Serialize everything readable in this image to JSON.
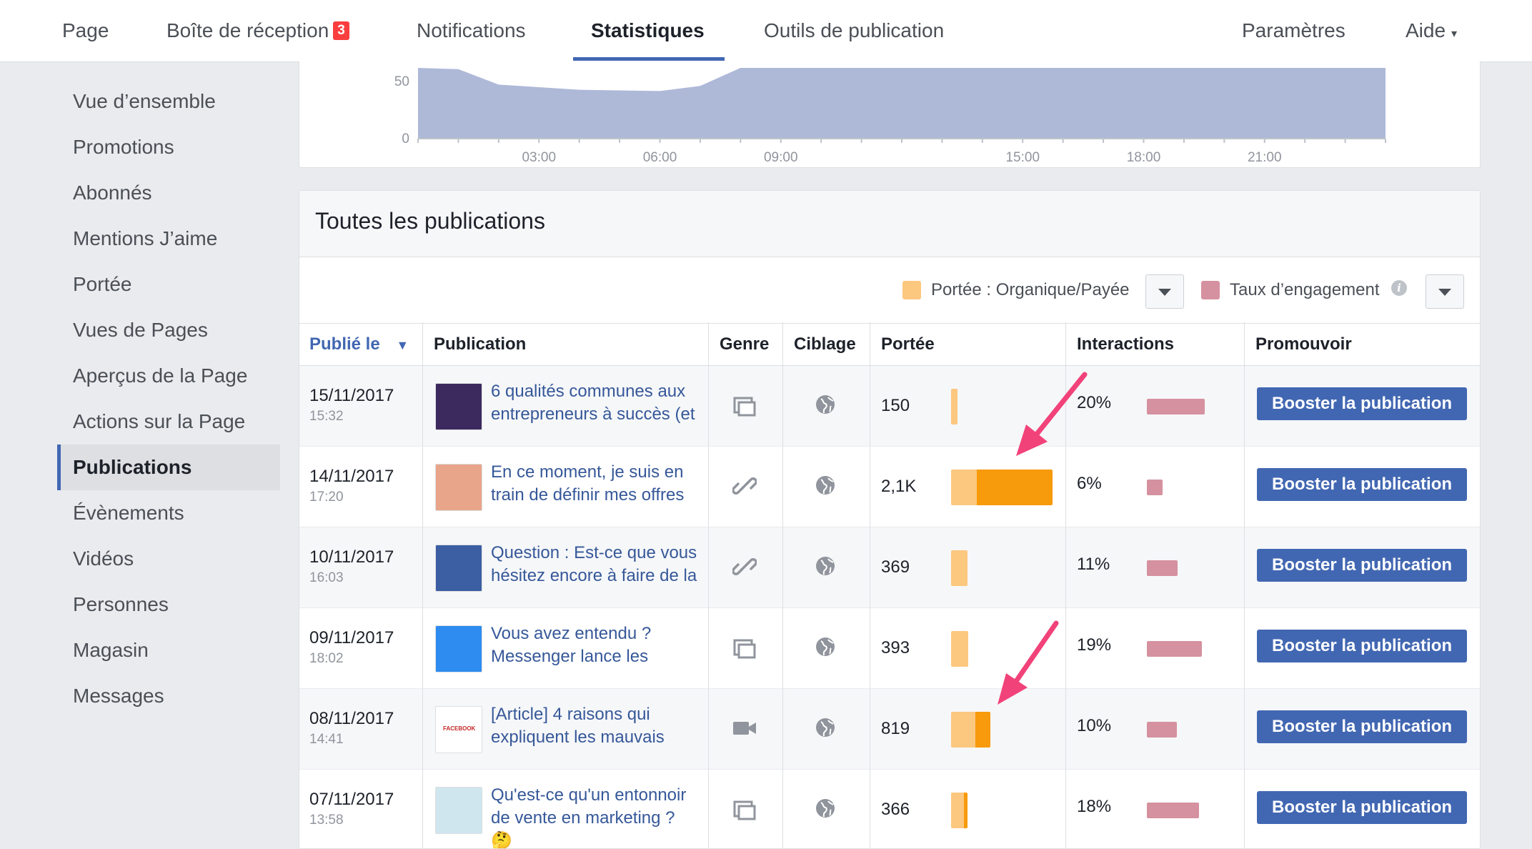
{
  "topnav": {
    "tabs": [
      {
        "label": "Page"
      },
      {
        "label": "Boîte de réception",
        "badge": "3"
      },
      {
        "label": "Notifications"
      },
      {
        "label": "Statistiques",
        "active": true
      },
      {
        "label": "Outils de publication"
      }
    ],
    "right": [
      {
        "label": "Paramètres"
      },
      {
        "label": "Aide",
        "caret": "▾"
      }
    ]
  },
  "sidebar": {
    "items": [
      {
        "label": "Vue d’ensemble"
      },
      {
        "label": "Promotions"
      },
      {
        "label": "Abonnés"
      },
      {
        "label": "Mentions J’aime"
      },
      {
        "label": "Portée"
      },
      {
        "label": "Vues de Pages"
      },
      {
        "label": "Aperçus de la Page"
      },
      {
        "label": "Actions sur la Page"
      },
      {
        "label": "Publications",
        "active": true
      },
      {
        "label": "Évènements"
      },
      {
        "label": "Vidéos"
      },
      {
        "label": "Personnes"
      },
      {
        "label": "Magasin"
      },
      {
        "label": "Messages"
      }
    ]
  },
  "chart_data": {
    "type": "area",
    "y_ticks": [
      "50",
      "0"
    ],
    "x_ticks": [
      "03:00",
      "06:00",
      "09:00",
      "15:00",
      "18:00",
      "21:00"
    ],
    "x_hours": [
      0,
      1,
      2,
      3,
      4,
      5,
      6,
      7,
      8,
      9,
      10,
      11,
      12,
      13,
      14,
      15,
      16,
      17,
      18,
      19,
      20,
      21,
      22,
      23,
      24
    ],
    "values": [
      55,
      54,
      42,
      40,
      38,
      37.5,
      37,
      41,
      55,
      55,
      55,
      55,
      55,
      55,
      55,
      55,
      55,
      55,
      55,
      55,
      55,
      55,
      55,
      55,
      55
    ],
    "ylim": [
      0,
      50
    ],
    "color": "#aeb9d8"
  },
  "publications": {
    "title": "Toutes les publications",
    "legend": {
      "reach_label": "Portée : Organique/Payée",
      "reach_color": "#fcc77f",
      "engagement_label": "Taux d’engagement",
      "engagement_color": "#d5919f",
      "info": "i"
    },
    "columns": {
      "published": "Publié le",
      "sort_icon": "▼",
      "publication": "Publication",
      "genre": "Genre",
      "targeting": "Ciblage",
      "reach": "Portée",
      "interactions": "Interactions",
      "promote": "Promouvoir"
    },
    "boost_label": "Booster la publication",
    "rows": [
      {
        "date": "15/11/2017",
        "time": "15:32",
        "text": "6 qualités communes aux entrepreneurs à succès (et",
        "genre": "album-icon",
        "reach": "150",
        "organic": 0.06,
        "paid": 0,
        "rate": "20%",
        "eng": 0.58,
        "thumb": "#3c2a5e"
      },
      {
        "date": "14/11/2017",
        "time": "17:20",
        "text": "En ce moment, je suis en train de définir mes offres",
        "genre": "link-icon",
        "reach": "2,1K",
        "organic": 0.25,
        "paid": 0.75,
        "rate": "6%",
        "eng": 0.16,
        "thumb": "#e8a58a"
      },
      {
        "date": "10/11/2017",
        "time": "16:03",
        "text": "Question : Est-ce que vous hésitez encore à faire de la",
        "genre": "link-icon",
        "reach": "369",
        "organic": 0.16,
        "paid": 0,
        "rate": "11%",
        "eng": 0.31,
        "thumb": "#3c5fa3"
      },
      {
        "date": "09/11/2017",
        "time": "18:02",
        "text": "Vous avez entendu ? Messenger lance les",
        "genre": "album-icon",
        "reach": "393",
        "organic": 0.17,
        "paid": 0,
        "rate": "19%",
        "eng": 0.55,
        "thumb": "#2e8cf0"
      },
      {
        "date": "08/11/2017",
        "time": "14:41",
        "text": "[Article] 4 raisons qui expliquent les mauvais",
        "genre": "video-icon",
        "reach": "819",
        "organic": 0.24,
        "paid": 0.15,
        "rate": "10%",
        "eng": 0.3,
        "thumb": "#ffffff",
        "thumb_text": "FACEBOOK"
      },
      {
        "date": "07/11/2017",
        "time": "13:58",
        "text": "Qu'est-ce qu'un entonnoir de vente en marketing ? 🤔",
        "genre": "album-icon",
        "reach": "366",
        "organic": 0.13,
        "paid": 0.03,
        "rate": "18%",
        "eng": 0.52,
        "thumb": "#cfe6ee"
      }
    ]
  }
}
